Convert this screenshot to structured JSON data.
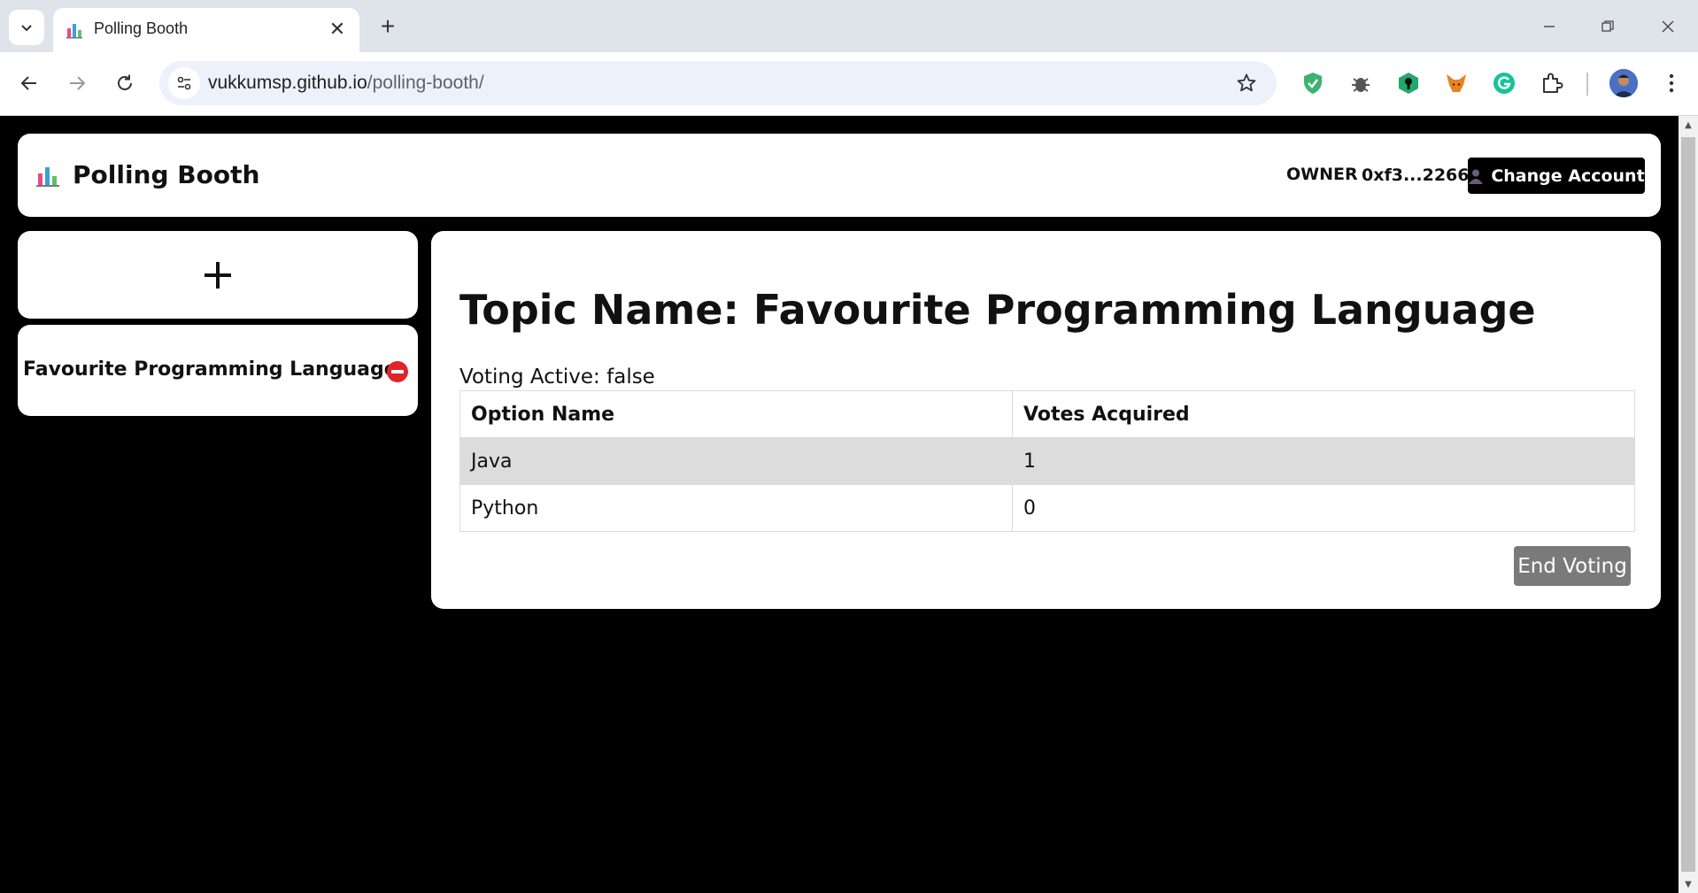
{
  "browser": {
    "tab_title": "Polling Booth",
    "url_host": "vukkumsp.github.io",
    "url_path": "/polling-booth/"
  },
  "app": {
    "title": "Polling Booth",
    "owner_label": "OWNER",
    "owner_address": "0xf3...2266",
    "change_account_label": "Change Account",
    "add_topic_label": "+"
  },
  "sidebar": {
    "topics": [
      {
        "title": "Favourite Programming Language"
      }
    ]
  },
  "topic": {
    "heading": "Topic Name: Favourite Programming Language",
    "voting_status": "Voting Active: false",
    "columns": [
      "Option Name",
      "Votes Acquired"
    ],
    "options": [
      {
        "name": "Java",
        "votes": "1"
      },
      {
        "name": "Python",
        "votes": "0"
      }
    ],
    "end_voting_label": "End Voting"
  },
  "colors": {
    "accent": "#000000",
    "delete": "#e0242a",
    "end_voting_button": "#7a7a7a",
    "row_highlight": "#dcdcdc"
  }
}
